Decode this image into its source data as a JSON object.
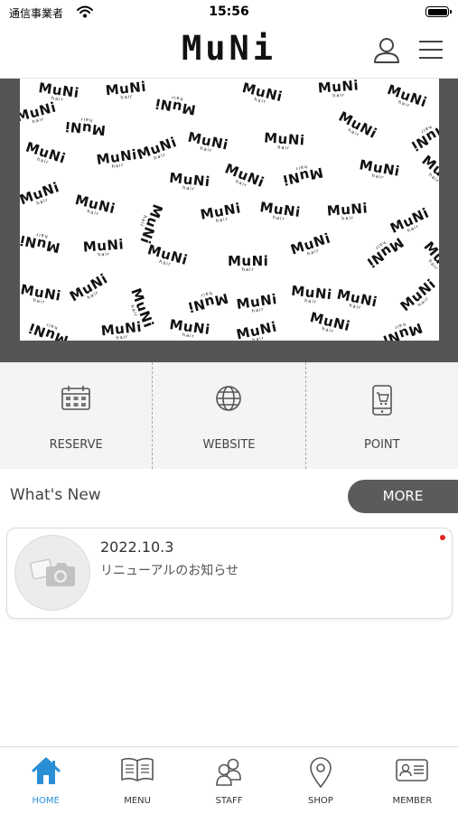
{
  "status_bar": {
    "carrier": "通信事業者",
    "time": "15:56"
  },
  "header": {
    "logo": "MuNi"
  },
  "hero": {
    "pattern_word": "MuNi",
    "pattern_subword": "hair"
  },
  "actions": [
    {
      "label": "RESERVE",
      "icon": "calendar-icon"
    },
    {
      "label": "WEBSITE",
      "icon": "globe-icon"
    },
    {
      "label": "POINT",
      "icon": "phone-cart-icon"
    }
  ],
  "whats_new": {
    "title": "What's New",
    "more_label": "MORE",
    "items": [
      {
        "date": "2022.10.3",
        "text": "リニューアルのお知らせ",
        "unread": true
      }
    ]
  },
  "tabbar": {
    "active": "HOME",
    "active_color": "#2a8ed6",
    "items": [
      {
        "label": "HOME",
        "icon": "home-icon"
      },
      {
        "label": "MENU",
        "icon": "book-icon"
      },
      {
        "label": "STAFF",
        "icon": "staff-icon"
      },
      {
        "label": "SHOP",
        "icon": "map-pin-icon"
      },
      {
        "label": "MEMBER",
        "icon": "member-card-icon"
      }
    ]
  }
}
